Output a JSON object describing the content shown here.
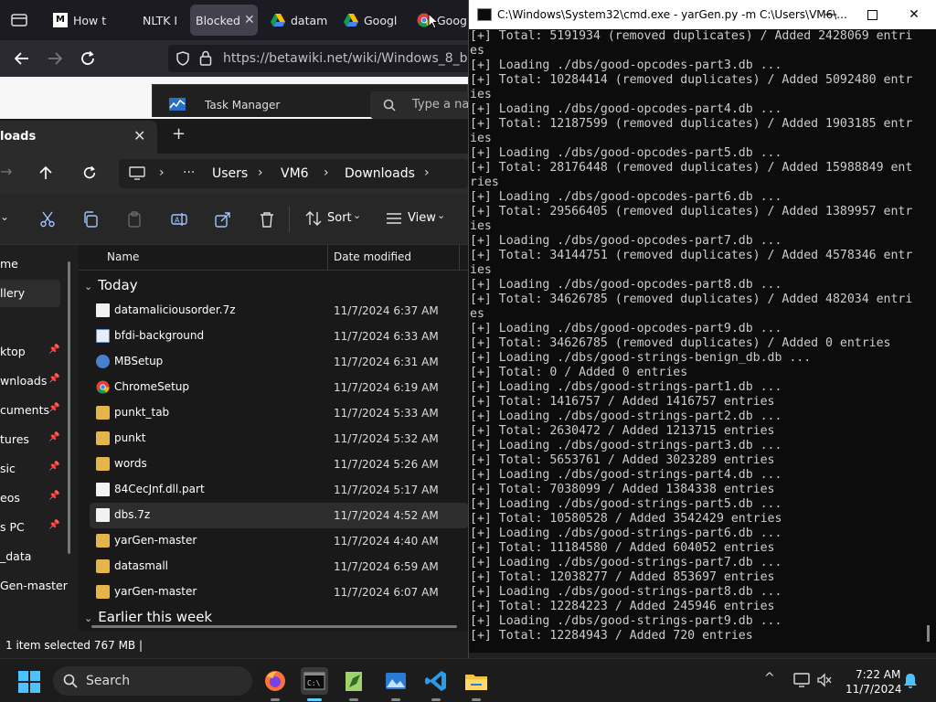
{
  "browser": {
    "tabs": [
      {
        "label": "How t",
        "icon": "medium-favicon-icon"
      },
      {
        "label": "NLTK I",
        "icon": "nltk-favicon-icon"
      },
      {
        "label": "Blocked",
        "icon": "none",
        "close": "✕"
      },
      {
        "label": "datam",
        "icon": "google-drive-icon"
      },
      {
        "label": "Googl",
        "icon": "google-drive-icon"
      },
      {
        "label": "Googl",
        "icon": "chrome-icon"
      }
    ],
    "url": "https://betawiki.net/wiki/Windows_8_build_8",
    "task_manager": {
      "title": "Task Manager",
      "search_placeholder": "Type a na"
    }
  },
  "explorer": {
    "tab_label": "loads",
    "breadcrumb": [
      "Users",
      "VM6",
      "Downloads"
    ],
    "toolbar": {
      "sort": "Sort",
      "view": "View"
    },
    "nav_items": [
      {
        "label": "me",
        "pinned": false
      },
      {
        "label": "llery",
        "pinned": false
      },
      {
        "label": "ktop",
        "pinned": true
      },
      {
        "label": "wnloads",
        "pinned": true
      },
      {
        "label": "cuments",
        "pinned": true
      },
      {
        "label": "tures",
        "pinned": true
      },
      {
        "label": "sic",
        "pinned": true
      },
      {
        "label": "eos",
        "pinned": true
      },
      {
        "label": "s PC",
        "pinned": true
      },
      {
        "label": "_data",
        "pinned": false
      },
      {
        "label": "Gen-master",
        "pinned": false
      }
    ],
    "columns": {
      "name": "Name",
      "date": "Date modified"
    },
    "group_today": "Today",
    "group_earlier": "Earlier this week",
    "files": [
      {
        "name": "datamaliciousorder.7z",
        "date": "11/7/2024 6:37 AM",
        "type": "doc"
      },
      {
        "name": "bfdi-background",
        "date": "11/7/2024 6:33 AM",
        "type": "image"
      },
      {
        "name": "MBSetup",
        "date": "11/7/2024 6:31 AM",
        "type": "setup"
      },
      {
        "name": "ChromeSetup",
        "date": "11/7/2024 6:19 AM",
        "type": "chrome"
      },
      {
        "name": "punkt_tab",
        "date": "11/7/2024 5:33 AM",
        "type": "folder"
      },
      {
        "name": "punkt",
        "date": "11/7/2024 5:32 AM",
        "type": "folder"
      },
      {
        "name": "words",
        "date": "11/7/2024 5:26 AM",
        "type": "folder"
      },
      {
        "name": "84CecJnf.dll.part",
        "date": "11/7/2024 5:17 AM",
        "type": "doc"
      },
      {
        "name": "dbs.7z",
        "date": "11/7/2024 4:52 AM",
        "type": "doc",
        "selected": true
      },
      {
        "name": "yarGen-master",
        "date": "11/7/2024 4:40 AM",
        "type": "folder"
      },
      {
        "name": "datasmall",
        "date": "11/7/2024 6:59 AM",
        "type": "folder"
      },
      {
        "name": "yarGen-master",
        "date": "11/7/2024 6:07 AM",
        "type": "folder"
      }
    ],
    "status": "1 item selected  767 MB  |"
  },
  "cmd": {
    "title": "C:\\Windows\\System32\\cmd.exe - yarGen.py  -m C:\\Users\\VM6\\...",
    "lines": [
      "[+] Total: 5191934 (removed duplicates) / Added 2428069 entri",
      "es",
      "[+] Loading ./dbs/good-opcodes-part3.db ...",
      "[+] Total: 10284414 (removed duplicates) / Added 5092480 entr",
      "ies",
      "[+] Loading ./dbs/good-opcodes-part4.db ...",
      "[+] Total: 12187599 (removed duplicates) / Added 1903185 entr",
      "ies",
      "[+] Loading ./dbs/good-opcodes-part5.db ...",
      "[+] Total: 28176448 (removed duplicates) / Added 15988849 ent",
      "ries",
      "[+] Loading ./dbs/good-opcodes-part6.db ...",
      "[+] Total: 29566405 (removed duplicates) / Added 1389957 entr",
      "ies",
      "[+] Loading ./dbs/good-opcodes-part7.db ...",
      "[+] Total: 34144751 (removed duplicates) / Added 4578346 entr",
      "ies",
      "[+] Loading ./dbs/good-opcodes-part8.db ...",
      "[+] Total: 34626785 (removed duplicates) / Added 482034 entri",
      "es",
      "[+] Loading ./dbs/good-opcodes-part9.db ...",
      "[+] Total: 34626785 (removed duplicates) / Added 0 entries",
      "[+] Loading ./dbs/good-strings-benign_db.db ...",
      "[+] Total: 0 / Added 0 entries",
      "[+] Loading ./dbs/good-strings-part1.db ...",
      "[+] Total: 1416757 / Added 1416757 entries",
      "[+] Loading ./dbs/good-strings-part2.db ...",
      "[+] Total: 2630472 / Added 1213715 entries",
      "[+] Loading ./dbs/good-strings-part3.db ...",
      "[+] Total: 5653761 / Added 3023289 entries",
      "[+] Loading ./dbs/good-strings-part4.db ...",
      "[+] Total: 7038099 / Added 1384338 entries",
      "[+] Loading ./dbs/good-strings-part5.db ...",
      "[+] Total: 10580528 / Added 3542429 entries",
      "[+] Loading ./dbs/good-strings-part6.db ...",
      "[+] Total: 11184580 / Added 604052 entries",
      "[+] Loading ./dbs/good-strings-part7.db ...",
      "[+] Total: 12038277 / Added 853697 entries",
      "[+] Loading ./dbs/good-strings-part8.db ...",
      "[+] Total: 12284223 / Added 245946 entries",
      "[+] Loading ./dbs/good-strings-part9.db ...",
      "[+] Total: 12284943 / Added 720 entries"
    ]
  },
  "taskbar": {
    "search_label": "Search",
    "apps": [
      "firefox-icon",
      "terminal-icon",
      "notepad-plus-icon",
      "photos-icon",
      "vscode-icon",
      "file-explorer-icon"
    ],
    "time": "7:22 AM",
    "date": "11/7/2024"
  },
  "colors": {
    "accent": "#0078d4",
    "folder": "#e6b54a",
    "cmd_bg": "#0c0c0c",
    "cmd_text": "#cccccc"
  }
}
